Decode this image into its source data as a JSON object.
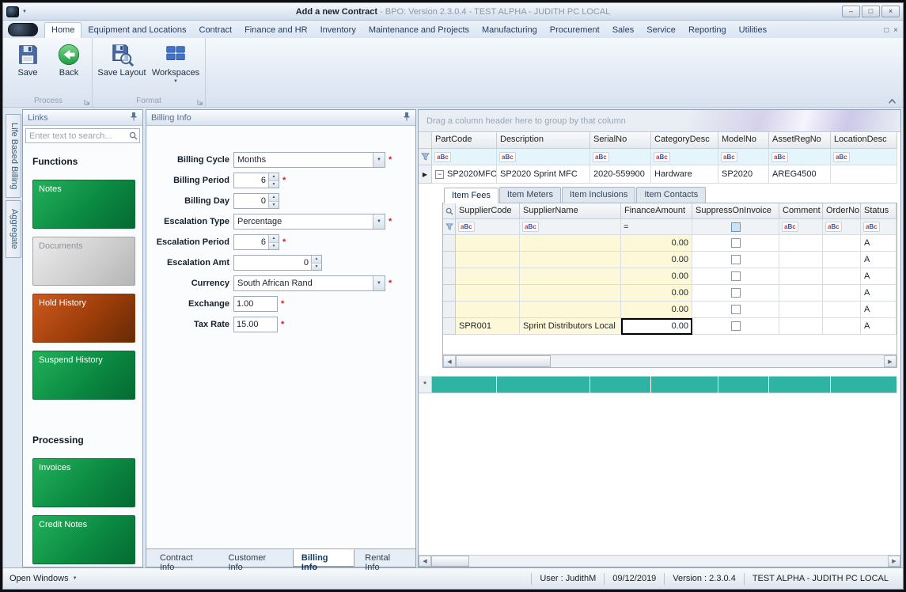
{
  "titlebar": {
    "title_bold": "Add a new Contract",
    "title_rest": " - BPO: Version 2.3.0.4 - TEST ALPHA - JUDITH PC LOCAL"
  },
  "ribbon": {
    "tabs": [
      {
        "label": "Home",
        "active": true
      },
      {
        "label": "Equipment and Locations"
      },
      {
        "label": "Contract"
      },
      {
        "label": "Finance and HR"
      },
      {
        "label": "Inventory"
      },
      {
        "label": "Maintenance and Projects"
      },
      {
        "label": "Manufacturing"
      },
      {
        "label": "Procurement"
      },
      {
        "label": "Sales"
      },
      {
        "label": "Service"
      },
      {
        "label": "Reporting"
      },
      {
        "label": "Utilities"
      }
    ],
    "save_label": "Save",
    "back_label": "Back",
    "save_layout_label": "Save Layout",
    "workspaces_label": "Workspaces",
    "groups": {
      "process": "Process",
      "format": "Format"
    }
  },
  "side_tabs": [
    {
      "label": "Life Based Billing"
    },
    {
      "label": "Aggregate"
    }
  ],
  "links": {
    "title": "Links",
    "search_placeholder": "Enter text to search...",
    "functions_heading": "Functions",
    "processing_heading": "Processing",
    "function_buttons": [
      {
        "label": "Notes",
        "style": "green"
      },
      {
        "label": "Documents",
        "style": "silver"
      },
      {
        "label": "Hold History",
        "style": "rust"
      },
      {
        "label": "Suspend History",
        "style": "green"
      }
    ],
    "processing_buttons": [
      {
        "label": "Invoices",
        "style": "green"
      },
      {
        "label": "Credit Notes",
        "style": "green"
      }
    ]
  },
  "billing": {
    "title": "Billing Info",
    "required_marker": "*",
    "fields": {
      "billing_cycle": {
        "label": "Billing Cycle",
        "value": "Months",
        "required": true
      },
      "billing_period": {
        "label": "Billing Period",
        "value": "6",
        "required": true
      },
      "billing_day": {
        "label": "Billing Day",
        "value": "0",
        "required": false
      },
      "escalation_type": {
        "label": "Escalation Type",
        "value": "Percentage",
        "required": true
      },
      "escalation_period": {
        "label": "Escalation Period",
        "value": "6",
        "required": true
      },
      "escalation_amt": {
        "label": "Escalation Amt",
        "value": "0",
        "required": false
      },
      "currency": {
        "label": "Currency",
        "value": "South African Rand",
        "required": true
      },
      "exchange": {
        "label": "Exchange",
        "value": "1.00",
        "required": true
      },
      "tax_rate": {
        "label": "Tax Rate",
        "value": "15.00",
        "required": true
      }
    },
    "tabs": [
      {
        "label": "Contract Info"
      },
      {
        "label": "Customer Info"
      },
      {
        "label": "Billing Info",
        "active": true
      },
      {
        "label": "Rental Info"
      }
    ]
  },
  "grid": {
    "group_hint": "Drag a column header here to group by that column",
    "columns": [
      {
        "label": "PartCode"
      },
      {
        "label": "Description"
      },
      {
        "label": "SerialNo"
      },
      {
        "label": "CategoryDesc"
      },
      {
        "label": "ModelNo"
      },
      {
        "label": "AssetRegNo"
      },
      {
        "label": "LocationDesc"
      }
    ],
    "master_row": {
      "part_code": "SP2020MFC",
      "description": "SP2020 Sprint MFC",
      "serial_no": "2020-559900",
      "category_desc": "Hardware",
      "model_no": "SP2020",
      "asset_reg_no": "AREG4500",
      "location_desc": ""
    },
    "detail": {
      "tabs": [
        {
          "label": "Item Fees",
          "active": true
        },
        {
          "label": "Item Meters"
        },
        {
          "label": "Item Inclusions"
        },
        {
          "label": "Item Contacts"
        }
      ],
      "columns": [
        {
          "label": "SupplierCode"
        },
        {
          "label": "SupplierName"
        },
        {
          "label": "FinanceAmount"
        },
        {
          "label": "SuppressOnInvoice"
        },
        {
          "label": "Comment"
        },
        {
          "label": "OrderNo"
        },
        {
          "label": "Status"
        }
      ],
      "filter_equals": "=",
      "filter_checkbox_state": "indeterminate",
      "rows": [
        {
          "supplier_code": "",
          "supplier_name": "",
          "finance_amount": "0.00",
          "suppress_on_invoice": false,
          "comment": "",
          "order_no": "",
          "status": "A"
        },
        {
          "supplier_code": "",
          "supplier_name": "",
          "finance_amount": "0.00",
          "suppress_on_invoice": false,
          "comment": "",
          "order_no": "",
          "status": "A"
        },
        {
          "supplier_code": "",
          "supplier_name": "",
          "finance_amount": "0.00",
          "suppress_on_invoice": false,
          "comment": "",
          "order_no": "",
          "status": "A"
        },
        {
          "supplier_code": "",
          "supplier_name": "",
          "finance_amount": "0.00",
          "suppress_on_invoice": false,
          "comment": "",
          "order_no": "",
          "status": "A"
        },
        {
          "supplier_code": "",
          "supplier_name": "",
          "finance_amount": "0.00",
          "suppress_on_invoice": false,
          "comment": "",
          "order_no": "",
          "status": "A"
        },
        {
          "supplier_code": "SPR001",
          "supplier_name": "Sprint Distributors Local",
          "finance_amount": "0.00",
          "suppress_on_invoice": false,
          "comment": "",
          "order_no": "",
          "status": "A",
          "focused_cell": "finance_amount"
        }
      ]
    }
  },
  "statusbar": {
    "open_windows": "Open Windows",
    "user": "User : JudithM",
    "date": "09/12/2019",
    "version": "Version : 2.3.0.4",
    "environment": "TEST ALPHA - JUDITH PC LOCAL"
  },
  "icons": {
    "dropdown_arrow": "▼",
    "spin_up": "▲",
    "spin_down": "▼",
    "row_indicator": "▶",
    "collapse_minus": "−",
    "scroll_left": "◀",
    "scroll_right": "▶",
    "minimize_glyph": "–",
    "restore_glyph": "□",
    "close_glyph": "×",
    "new_row_asterisk": "*"
  },
  "abc_icon": {
    "a": "a",
    "B": "B",
    "c": "c"
  },
  "colors": {
    "accent_green": "#0b8a42",
    "accent_rust": "#9c3c0a",
    "accent_silver": "#cfcfcf",
    "new_row_teal": "#2fb3a3",
    "filter_row_cyan": "#e4f6fc",
    "editable_cell_yellow": "#fcf8d8",
    "required_red": "#cc2222"
  }
}
